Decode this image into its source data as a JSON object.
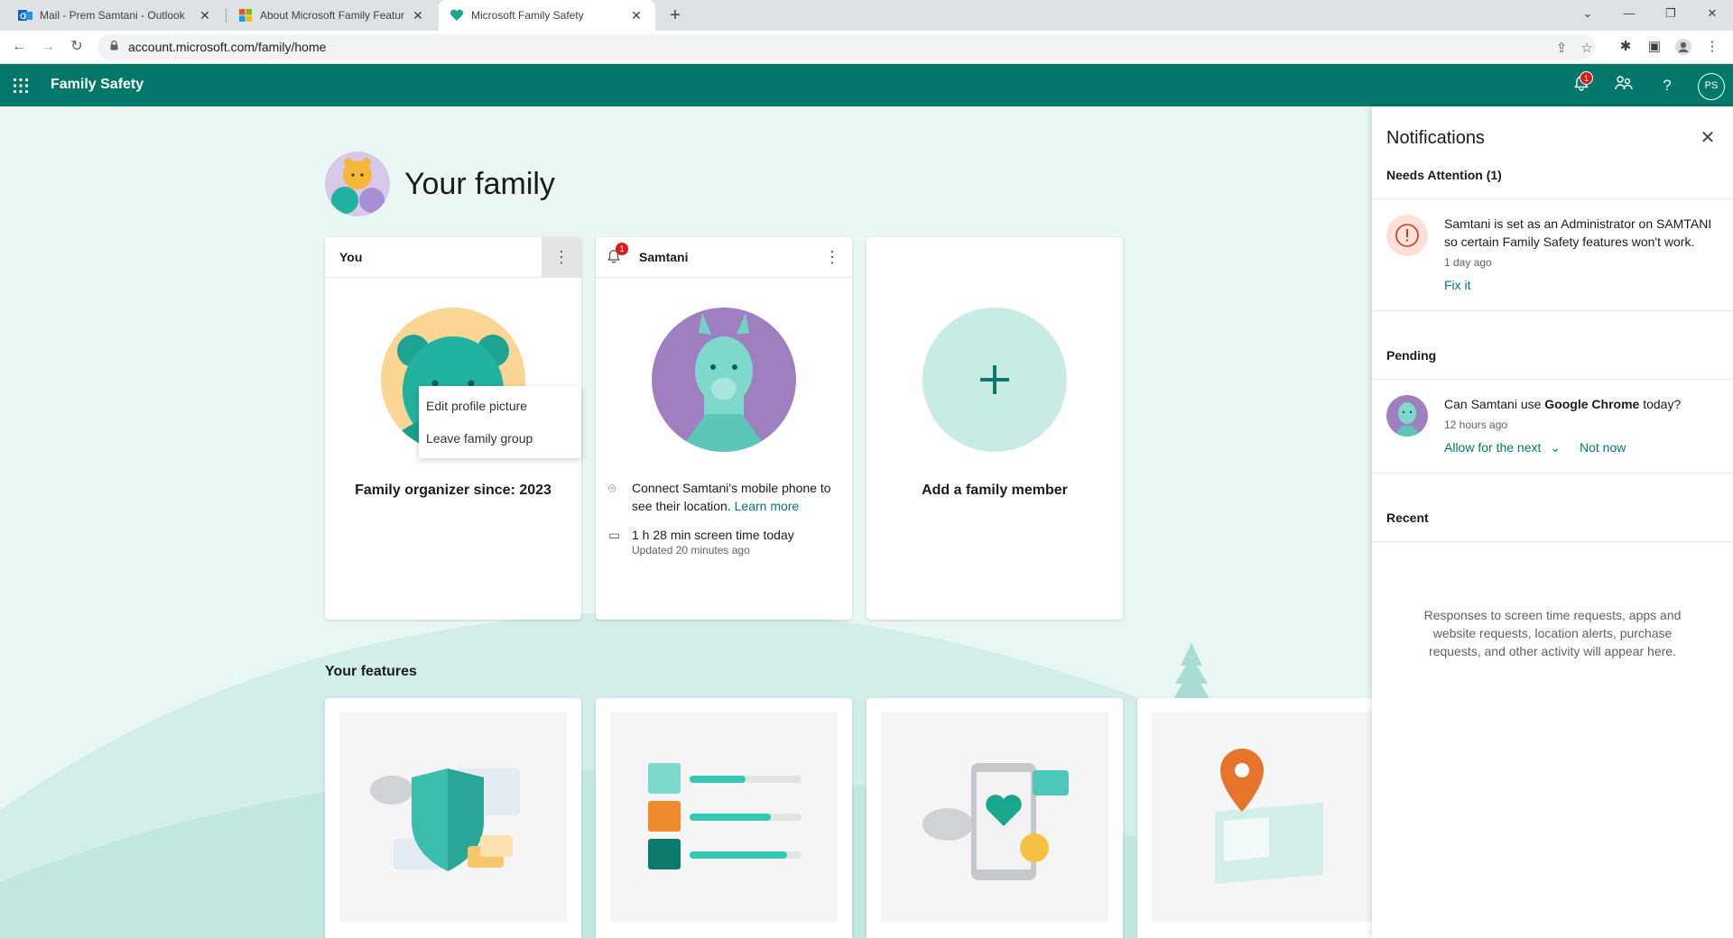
{
  "browser": {
    "tabs": [
      {
        "title": "Mail - Prem Samtani - Outlook"
      },
      {
        "title": "About Microsoft Family Features"
      },
      {
        "title": "Microsoft Family Safety"
      }
    ],
    "url": "account.microsoft.com/family/home"
  },
  "header": {
    "app_name": "Family Safety",
    "notification_count": "1",
    "user_initials": "PS"
  },
  "family": {
    "title": "Your family",
    "members": [
      {
        "name": "You",
        "caption": "Family organizer since: 2023"
      },
      {
        "name": "Samtani",
        "badge": "1",
        "location_text": "Connect Samtani's mobile phone to see their location.",
        "learn_more": "Learn more",
        "screen_time": "1 h 28 min screen time today",
        "updated": "Updated 20 minutes ago"
      }
    ],
    "add_member": "Add a family member",
    "menu": [
      "Edit profile picture",
      "Leave family group"
    ]
  },
  "features": {
    "title": "Your features"
  },
  "notifications": {
    "title": "Notifications",
    "needs_attention": {
      "title": "Needs Attention (1)",
      "message": "Samtani is set as an Administrator on SAMTANI so certain Family Safety features won't work.",
      "time": "1 day ago",
      "action": "Fix it"
    },
    "pending": {
      "title": "Pending",
      "question_prefix": "Can Samtani use ",
      "app": "Google Chrome",
      "question_suffix": " today?",
      "time": "12 hours ago",
      "allow": "Allow for the next",
      "deny": "Not now"
    },
    "recent": {
      "title": "Recent",
      "empty": "Responses to screen time requests, apps and website requests, location alerts, purchase requests, and other activity will appear here."
    }
  },
  "colors": {
    "brand": "#03786a",
    "accent": "#2fc9b4",
    "badge": "#d91b1b"
  }
}
